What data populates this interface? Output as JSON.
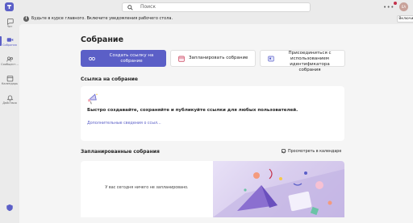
{
  "titlebar": {
    "search_placeholder": "Поиск",
    "more": "•••",
    "avatar_initials": "EA"
  },
  "rail": {
    "items": [
      {
        "label": "Чат",
        "icon": "chat-icon"
      },
      {
        "label": "Собрания",
        "icon": "video-icon"
      },
      {
        "label": "Сообщест...",
        "icon": "communities-icon"
      },
      {
        "label": "Календарь",
        "icon": "calendar-icon"
      },
      {
        "label": "Действия",
        "icon": "bell-icon"
      }
    ],
    "active_index": 1
  },
  "banner": {
    "text": "Будьте в курсе главного. Включите уведомления рабочего стола.",
    "enable_label": "Включить"
  },
  "page": {
    "title": "Собрание",
    "actions": [
      {
        "label": "Создать ссылку на собрание",
        "icon": "link-icon"
      },
      {
        "label": "Запланировать собрание",
        "icon": "calendar-icon"
      },
      {
        "label": "Присоединиться с использованием идентификатора собрания",
        "icon": "id-icon"
      }
    ]
  },
  "links_section": {
    "title": "Ссылка на собрание",
    "description": "Быстро создавайте, сохраняйте и публикуйте ссылки для любых пользователей.",
    "more_link": "Дополнительные сведения о ссыл..."
  },
  "scheduled_section": {
    "title": "Запланированные собрания",
    "calendar_toggle": "Просмотреть в календаре",
    "empty_text": "У вас сегодня ничего не запланировано."
  },
  "colors": {
    "accent": "#5b5fc7",
    "background": "#f5f5f5",
    "rail": "#ebebeb"
  }
}
